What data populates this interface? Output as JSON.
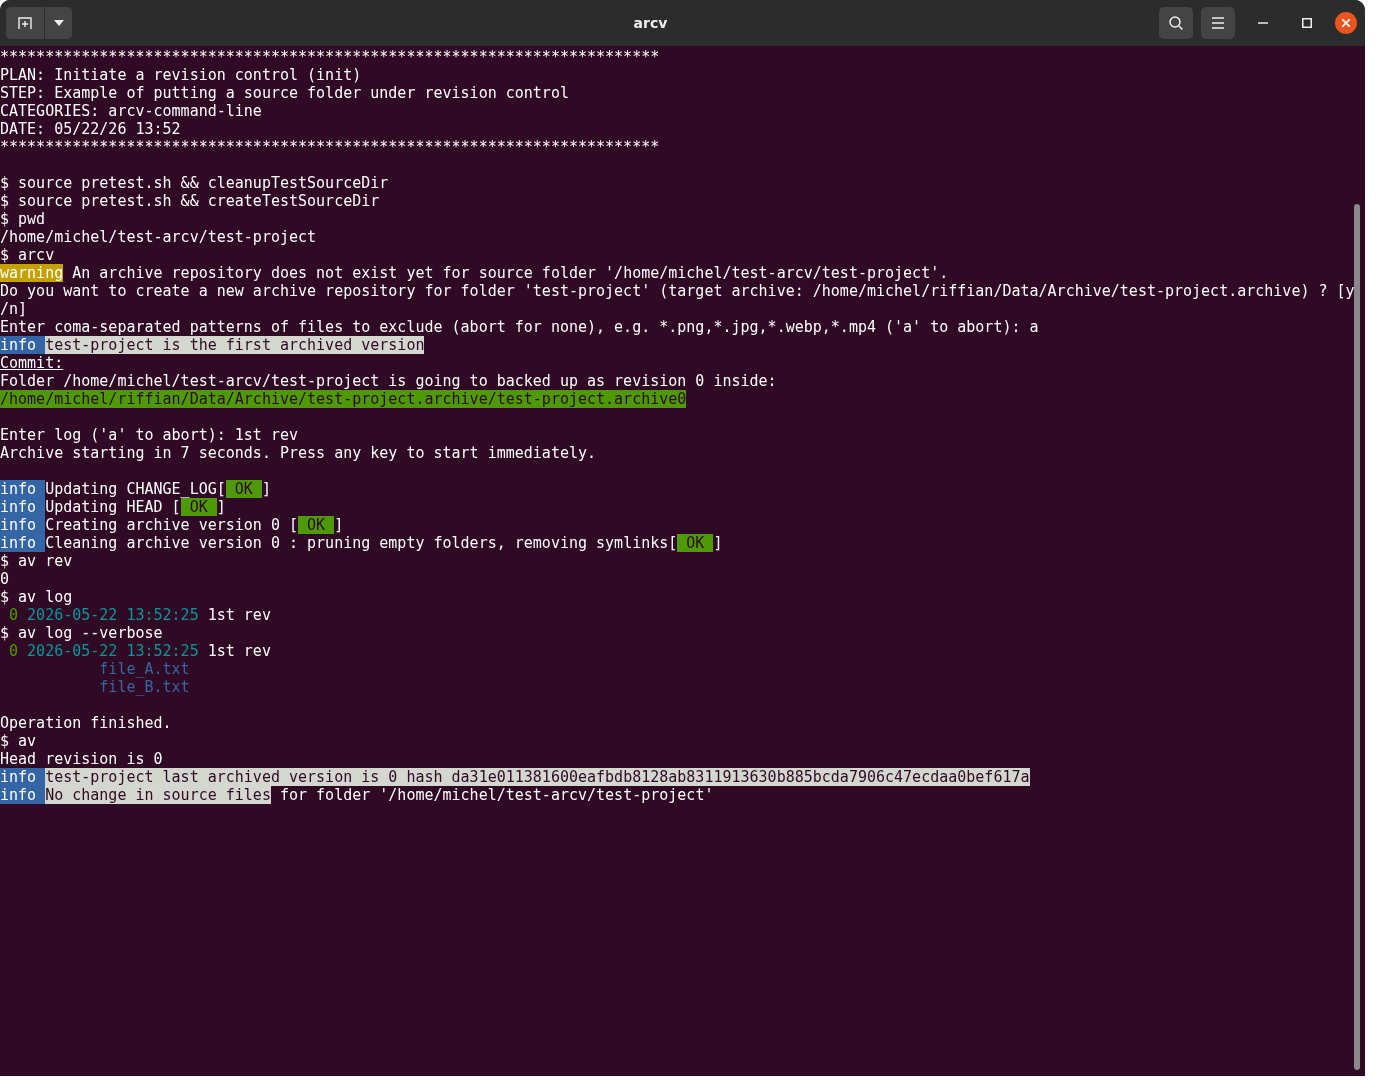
{
  "window": {
    "title": "arcv"
  },
  "blocks": [
    {
      "lines": [
        [
          {
            "text": "*************************************************************************",
            "kind": "plain"
          }
        ],
        [
          {
            "text": "PLAN: Initiate a revision control (init)",
            "kind": "plain"
          }
        ],
        [
          {
            "text": "STEP: Example of putting a source folder under revision control",
            "kind": "plain"
          }
        ],
        [
          {
            "text": "CATEGORIES: arcv-command-line",
            "kind": "plain"
          }
        ],
        [
          {
            "text": "DATE: 05/22/26 13:52",
            "kind": "plain"
          }
        ],
        [
          {
            "text": "*************************************************************************",
            "kind": "plain"
          }
        ]
      ]
    },
    {
      "lines": [
        [
          {
            "text": "$ source pretest.sh && cleanupTestSourceDir",
            "kind": "plain"
          }
        ],
        [
          {
            "text": "$ source pretest.sh && createTestSourceDir",
            "kind": "plain"
          }
        ],
        [
          {
            "text": "$ pwd",
            "kind": "plain"
          }
        ],
        [
          {
            "text": "/home/michel/test-arcv/test-project",
            "kind": "plain"
          }
        ],
        [
          {
            "text": "$ arcv",
            "kind": "plain"
          }
        ],
        [
          {
            "text": "warning",
            "kind": "warning"
          },
          {
            "text": " An archive repository does not exist yet for source folder '/home/michel/test-arcv/test-project'.",
            "kind": "plain"
          }
        ],
        [
          {
            "text": "Do you want to create a new archive repository for folder 'test-project' (target archive: /home/michel/riffian/Data/Archive/test-project.archive) ? [y",
            "kind": "plain"
          }
        ],
        [
          {
            "text": "/n]",
            "kind": "plain"
          }
        ],
        [
          {
            "text": "Enter coma-separated patterns of files to exclude (abort for none), e.g. *.png,*.jpg,*.webp,*.mp4 ('a' to abort): a",
            "kind": "plain"
          }
        ],
        [
          {
            "text": "info ",
            "kind": "info"
          },
          {
            "text": "test-project is the first archived version",
            "kind": "highlight"
          }
        ],
        [
          {
            "text": "Commit:",
            "kind": "underline"
          }
        ],
        [
          {
            "text": "Folder /home/michel/test-arcv/test-project is going to backed up as revision 0 inside:",
            "kind": "plain"
          }
        ],
        [
          {
            "text": "/home/michel/riffian/Data/Archive/test-project.archive/test-project.archive0",
            "kind": "path"
          }
        ]
      ]
    },
    {
      "lines": [
        [
          {
            "text": "Enter log ('a' to abort): 1st rev",
            "kind": "plain"
          }
        ],
        [
          {
            "text": "Archive starting in 7 seconds. Press any key to start immediately.",
            "kind": "plain"
          }
        ]
      ]
    },
    {
      "lines": [
        [
          {
            "text": "info ",
            "kind": "info"
          },
          {
            "text": "Updating CHANGE_LOG[",
            "kind": "plain"
          },
          {
            "text": " OK ",
            "kind": "ok"
          },
          {
            "text": "]",
            "kind": "plain"
          }
        ],
        [
          {
            "text": "info ",
            "kind": "info"
          },
          {
            "text": "Updating HEAD [",
            "kind": "plain"
          },
          {
            "text": " OK ",
            "kind": "ok"
          },
          {
            "text": "]",
            "kind": "plain"
          }
        ],
        [
          {
            "text": "info ",
            "kind": "info"
          },
          {
            "text": "Creating archive version 0 [",
            "kind": "plain"
          },
          {
            "text": " OK ",
            "kind": "ok"
          },
          {
            "text": "]",
            "kind": "plain"
          }
        ],
        [
          {
            "text": "info ",
            "kind": "info"
          },
          {
            "text": "Cleaning archive version 0 : pruning empty folders, removing symlinks[",
            "kind": "plain"
          },
          {
            "text": " OK ",
            "kind": "ok"
          },
          {
            "text": "]",
            "kind": "plain"
          }
        ],
        [
          {
            "text": "$ av rev",
            "kind": "plain"
          }
        ],
        [
          {
            "text": "0",
            "kind": "plain"
          }
        ],
        [
          {
            "text": "$ av log",
            "kind": "plain"
          }
        ],
        [
          {
            "text": " 0",
            "kind": "revision"
          },
          {
            "text": " 2026-05-22 13:52:25",
            "kind": "date"
          },
          {
            "text": " 1st rev",
            "kind": "plain"
          }
        ],
        [
          {
            "text": "$ av log --verbose",
            "kind": "plain"
          }
        ],
        [
          {
            "text": " 0",
            "kind": "revision"
          },
          {
            "text": " 2026-05-22 13:52:25",
            "kind": "date"
          },
          {
            "text": " 1st rev",
            "kind": "plain"
          }
        ],
        [
          {
            "text": "           file_A.txt",
            "kind": "file"
          }
        ],
        [
          {
            "text": "           file_B.txt",
            "kind": "file"
          }
        ]
      ]
    },
    {
      "lines": [
        [
          {
            "text": "Operation finished.",
            "kind": "plain"
          }
        ],
        [
          {
            "text": "$ av",
            "kind": "plain"
          }
        ],
        [
          {
            "text": "Head revision is 0",
            "kind": "plain"
          }
        ],
        [
          {
            "text": "info ",
            "kind": "info"
          },
          {
            "text": "test-project last archived version is 0 hash da31e011381600eafbdb8128ab8311913630b885bcda7906c47ecdaa0bef617a",
            "kind": "highlight"
          }
        ],
        [
          {
            "text": "info ",
            "kind": "info"
          },
          {
            "text": "No change in source files",
            "kind": "highlight"
          },
          {
            "text": " for folder '/home/michel/test-arcv/test-project'",
            "kind": "plain"
          }
        ]
      ]
    }
  ]
}
